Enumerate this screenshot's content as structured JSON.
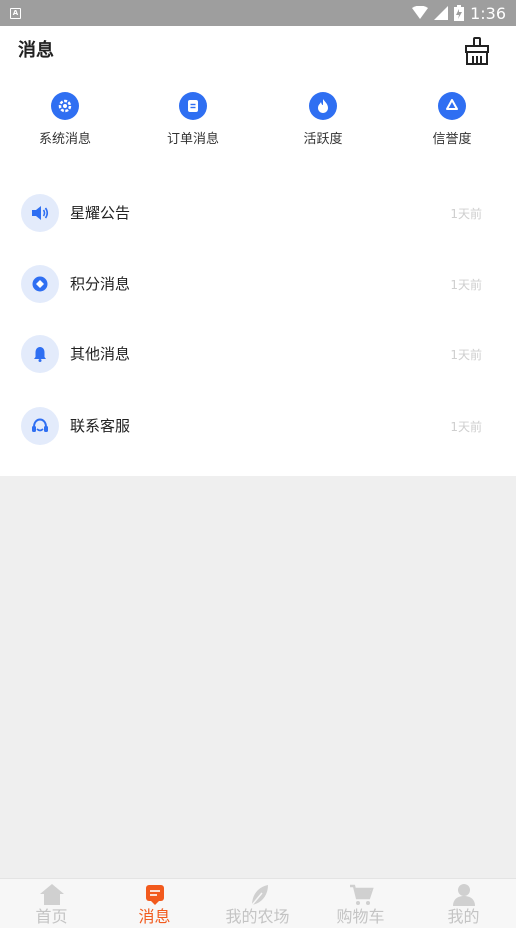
{
  "status_bar": {
    "notification_icon": "A",
    "time": "1:36",
    "icons": [
      "wifi-icon",
      "signal-icon",
      "battery-icon"
    ]
  },
  "header": {
    "title": "消息",
    "action_icon": "broom-clean-icon"
  },
  "quick_actions": [
    {
      "label": "系统消息",
      "icon": "system-gear-icon"
    },
    {
      "label": "订单消息",
      "icon": "order-clipboard-icon"
    },
    {
      "label": "活跃度",
      "icon": "flame-icon"
    },
    {
      "label": "信誉度",
      "icon": "recycle-icon"
    }
  ],
  "messages": [
    {
      "title": "星耀公告",
      "time": "1天前",
      "icon": "speaker-icon"
    },
    {
      "title": "积分消息",
      "time": "1天前",
      "icon": "diamond-points-icon"
    },
    {
      "title": "其他消息",
      "time": "1天前",
      "icon": "bell-icon"
    },
    {
      "title": "联系客服",
      "time": "1天前",
      "icon": "headset-icon"
    }
  ],
  "bottom_nav": [
    {
      "label": "首页",
      "icon": "home-icon",
      "active": false
    },
    {
      "label": "消息",
      "icon": "message-icon",
      "active": true
    },
    {
      "label": "我的农场",
      "icon": "leaf-icon",
      "active": false
    },
    {
      "label": "购物车",
      "icon": "cart-icon",
      "active": false
    },
    {
      "label": "我的",
      "icon": "person-icon",
      "active": false
    }
  ],
  "colors": {
    "accent_blue": "#2f6ff2",
    "icon_bg": "#e3ebfb",
    "active_orange": "#f25a1d",
    "inactive_gray": "#c4c4c4",
    "status_bar": "#9e9e9e"
  }
}
